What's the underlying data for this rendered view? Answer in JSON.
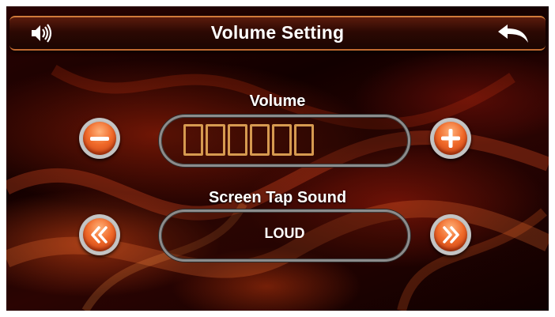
{
  "header": {
    "title": "Volume Setting",
    "left_icon": "speaker-icon",
    "right_icon": "back-arrow-icon"
  },
  "volume": {
    "label": "Volume",
    "level": 0,
    "max_level": 6,
    "decrease_icon": "minus-icon",
    "increase_icon": "plus-icon"
  },
  "tap_sound": {
    "label": "Screen Tap Sound",
    "value": "LOUD",
    "prev_icon": "double-chevron-left-icon",
    "next_icon": "double-chevron-right-icon"
  },
  "colors": {
    "accent_orange": "#f06a2a",
    "title_border": "#d07a3a",
    "bar_outline": "#d69a50",
    "background": "#1a0200"
  }
}
